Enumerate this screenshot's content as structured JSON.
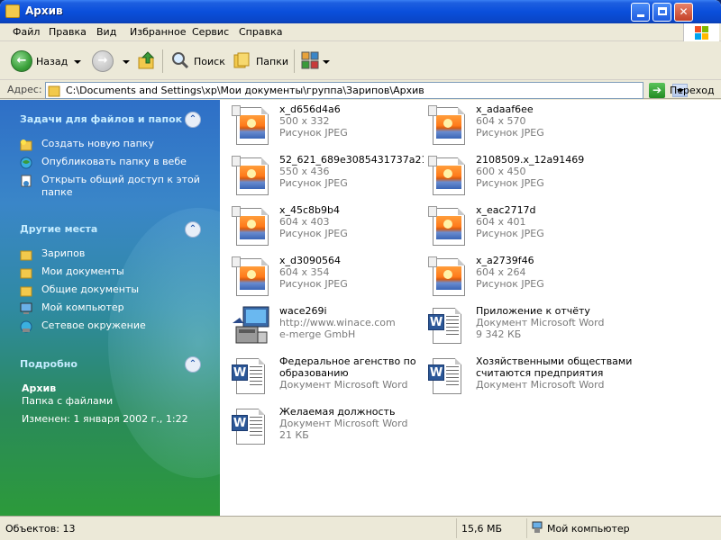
{
  "window": {
    "title": "Архив"
  },
  "menu": [
    "Файл",
    "Правка",
    "Вид",
    "Избранное",
    "Сервис",
    "Справка"
  ],
  "toolbar": {
    "back_label": "Назад",
    "search_label": "Поиск",
    "folders_label": "Папки"
  },
  "address": {
    "label": "Адрес:",
    "path": "C:\\Documents and Settings\\xp\\Мои документы\\группа\\Зарипов\\Архив",
    "go_label": "Переход"
  },
  "tasks": {
    "title": "Задачи для файлов и папок",
    "items": [
      "Создать новую папку",
      "Опубликовать папку в вебе",
      "Открыть общий доступ к этой",
      "папке"
    ]
  },
  "places": {
    "title": "Другие места",
    "items": [
      "Зарипов",
      "Мои документы",
      "Общие документы",
      "Мой компьютер",
      "Сетевое окружение"
    ]
  },
  "details": {
    "title": "Подробно",
    "name": "Архив",
    "type": "Папка с файлами",
    "modified": "Изменен: 1 января 2002 г., 1:22"
  },
  "files": [
    {
      "name": "x_d656d4a6",
      "line2": "500 x 332",
      "line3": "Рисунок JPEG",
      "kind": "jpeg"
    },
    {
      "name": "x_adaaf6ee",
      "line2": "604 x 570",
      "line3": "Рисунок JPEG",
      "kind": "jpeg"
    },
    {
      "name": "52_621_689e3085431737a21...",
      "line2": "550 x 436",
      "line3": "Рисунок JPEG",
      "kind": "jpeg"
    },
    {
      "name": "2108509.x_12a91469",
      "line2": "600 x 450",
      "line3": "Рисунок JPEG",
      "kind": "jpeg"
    },
    {
      "name": "x_45c8b9b4",
      "line2": "604 x 403",
      "line3": "Рисунок JPEG",
      "kind": "jpeg"
    },
    {
      "name": "x_eac2717d",
      "line2": "604 x 401",
      "line3": "Рисунок JPEG",
      "kind": "jpeg"
    },
    {
      "name": "x_d3090564",
      "line2": "604 x 354",
      "line3": "Рисунок JPEG",
      "kind": "jpeg"
    },
    {
      "name": "x_a2739f46",
      "line2": "604 x 264",
      "line3": "Рисунок JPEG",
      "kind": "jpeg"
    },
    {
      "name": "wace269i",
      "line2": "http://www.winace.com",
      "line3": "e-merge GmbH",
      "kind": "exe"
    },
    {
      "name": "Приложение к отчёту",
      "line2": "Документ Microsoft Word",
      "line3": "9 342 КБ",
      "kind": "doc"
    },
    {
      "name": "Федеральное агенство по образованию",
      "line2": "Документ Microsoft Word",
      "line3": "",
      "kind": "doc"
    },
    {
      "name": "Хозяйственными обществами считаются предприятия",
      "line2": "Документ Microsoft Word",
      "line3": "",
      "kind": "doc"
    },
    {
      "name": "Желаемая должность",
      "line2": "Документ Microsoft Word",
      "line3": "21 КБ",
      "kind": "doc"
    }
  ],
  "status": {
    "objects": "Объектов: 13",
    "size": "15,6 МБ",
    "location": "Мой компьютер"
  }
}
